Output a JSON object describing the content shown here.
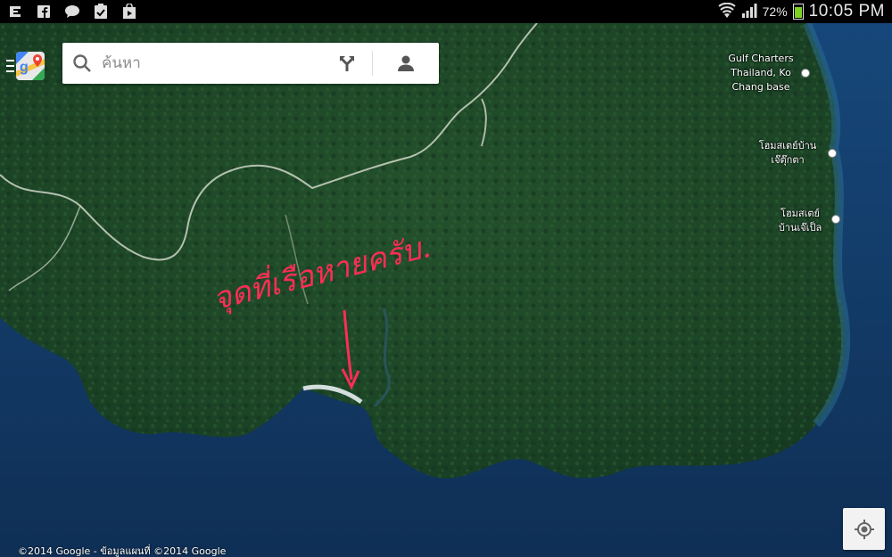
{
  "statusbar": {
    "battery_percent": "72%",
    "time": "10:05 PM",
    "left_icons": [
      "sync-icon",
      "facebook-icon",
      "chat-icon",
      "clipboard-check-icon",
      "shopping-bag-icon"
    ],
    "right_icons": [
      "wifi-icon",
      "signal-icon",
      "battery-icon"
    ]
  },
  "search": {
    "placeholder": "ค้นหา",
    "icons": [
      "search-icon",
      "directions-icon",
      "account-icon"
    ]
  },
  "map": {
    "pois": [
      {
        "lines": [
          "Gulf Charters",
          "Thailand, Ko",
          "Chang base"
        ]
      },
      {
        "lines": [
          "โฮมสเตย์บ้าน",
          "เจ๊ตุ๊กตา"
        ]
      },
      {
        "lines": [
          "โฮมสเตย์",
          "บ้านเจ๊เป็ล"
        ]
      }
    ],
    "annotation": "จุดที่เรือหายครับ.",
    "copyright": "©2014 Google - ข้อมูลแผนที่ ©2014 Google"
  },
  "colors": {
    "land": "#1f4a2a",
    "sea": "#123a63",
    "annotation": "#ff2d55"
  }
}
